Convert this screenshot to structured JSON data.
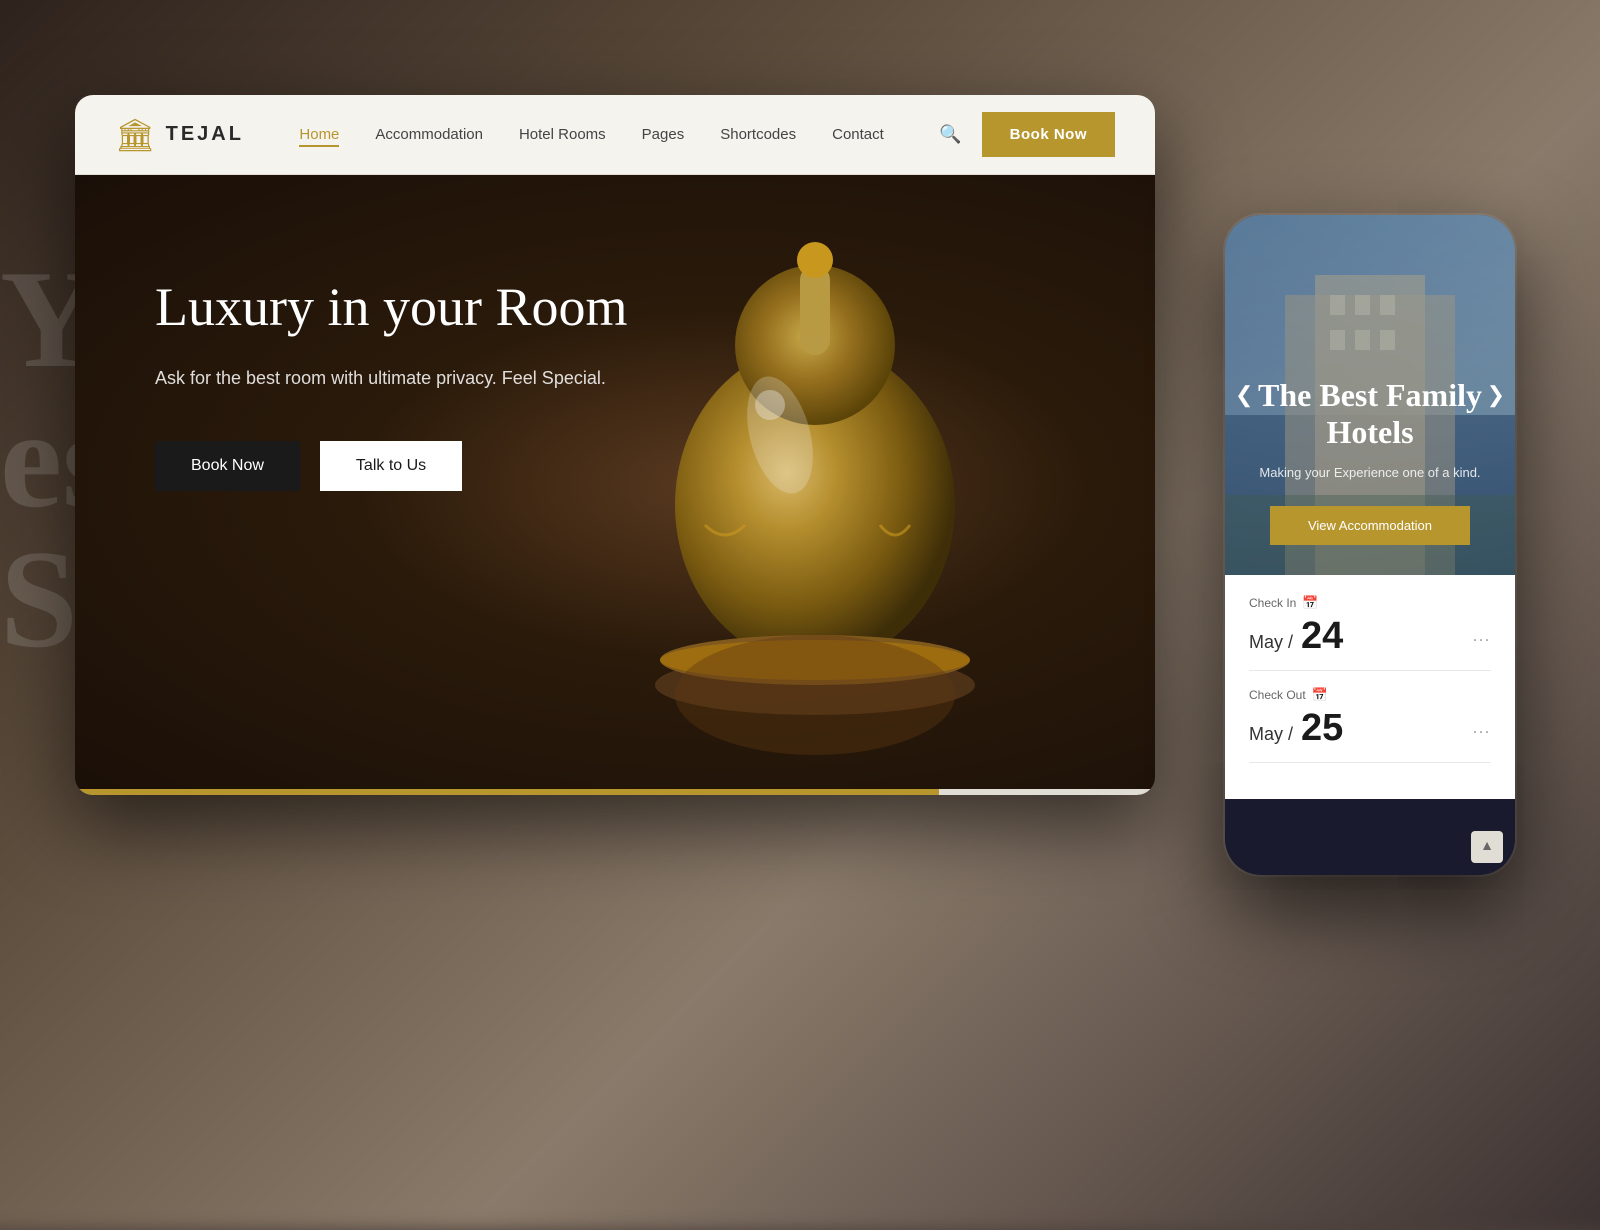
{
  "background": {
    "ghost_text_line1": "Y i",
    "ghost_text_line2": "est",
    "ghost_text_line3": "Sp"
  },
  "navbar": {
    "logo_text": "TEJAL",
    "nav_links": [
      {
        "label": "Home",
        "active": true
      },
      {
        "label": "Accommodation",
        "active": false
      },
      {
        "label": "Hotel Rooms",
        "active": false
      },
      {
        "label": "Pages",
        "active": false
      },
      {
        "label": "Shortcodes",
        "active": false
      },
      {
        "label": "Contact",
        "active": false
      }
    ],
    "book_now_label": "Book Now"
  },
  "hero": {
    "title": "Luxury in your Room",
    "subtitle": "Ask for the best room with ultimate privacy. Feel Special.",
    "book_now_label": "Book Now",
    "talk_to_us_label": "Talk to Us"
  },
  "mobile": {
    "hero_title": "The Best Family Hotels",
    "hero_subtitle": "Making your Experience one of a kind.",
    "view_accommodation_label": "View Accommodation",
    "slider_left": "❮",
    "slider_right": "❯",
    "checkin": {
      "label": "Check In",
      "month": "May /",
      "day": "24",
      "dots": "..."
    },
    "checkout": {
      "label": "Check Out",
      "month": "May /",
      "day": "25",
      "dots": "..."
    }
  },
  "colors": {
    "gold": "#b8962e",
    "dark": "#1a1a1a",
    "white": "#ffffff"
  }
}
